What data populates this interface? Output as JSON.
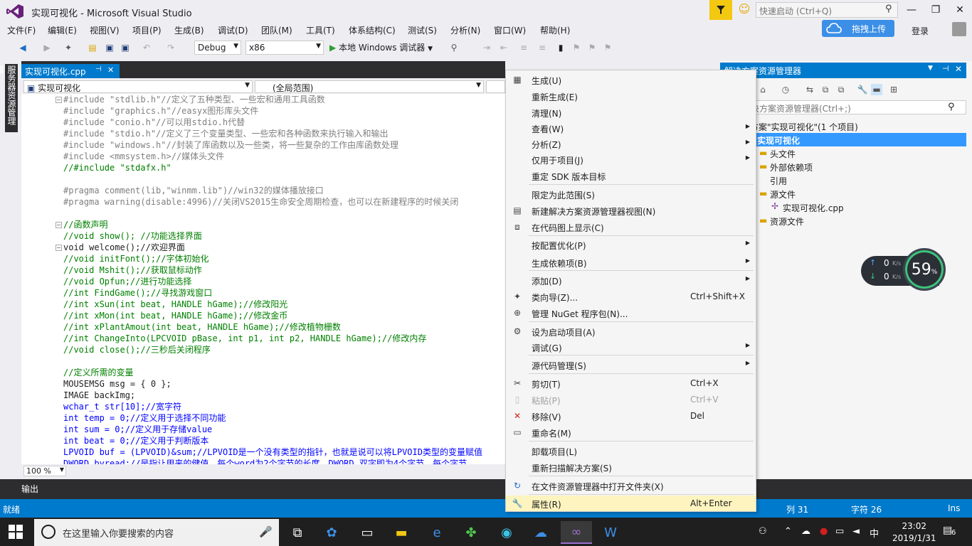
{
  "window": {
    "title": "实现可视化 - Microsoft Visual Studio",
    "quick_launch_placeholder": "快速启动 (Ctrl+Q)",
    "upload_label": "拖拽上传",
    "login_label": "登录"
  },
  "menu": [
    "文件(F)",
    "编辑(E)",
    "视图(V)",
    "项目(P)",
    "生成(B)",
    "调试(D)",
    "团队(M)",
    "工具(T)",
    "体系结构(C)",
    "测试(S)",
    "分析(N)",
    "窗口(W)",
    "帮助(H)"
  ],
  "toolbar": {
    "config": "Debug",
    "platform": "x86",
    "run_label": "本地 Windows 调试器"
  },
  "left_strip": {
    "server_tab": "服务器资源管理器"
  },
  "editor": {
    "tab_label": "实现可视化.cpp",
    "nav_project": "实现可视化",
    "nav_scope": "(全局范围)",
    "zoom": "100 %",
    "lines": [
      "#include \"stdlib.h\"//定义了五种类型、一些宏和通用工具函数",
      "#include \"graphics.h\"//easyx图形库头文件",
      "#include \"conio.h\"//可以用stdio.h代替",
      "#include \"stdio.h\"//定义了三个变量类型、一些宏和各种函数来执行输入和输出",
      "#include \"windows.h\"//封装了库函数以及一些类，将一些复杂的工作由库函数处理",
      "#include <mmsystem.h>//媒体头文件",
      "//#include \"stdafx.h\"",
      "",
      "#pragma comment(lib,\"winmm.lib\")//win32的媒体播放接口",
      "#pragma warning(disable:4996)//关闭VS2015生命安全周期检查，也可以在新建程序的时候关闭",
      "",
      "//函数声明",
      "//void show(); //功能选择界面",
      "void welcome();//欢迎界面",
      "//void initFont();//字体初始化",
      "//void Mshit();//获取鼠标动作",
      "//void Opfun;//进行功能选择",
      "//int FindGame();//寻找游戏窗口",
      "//int xSun(int beat, HANDLE hGame);//修改阳光",
      "//int xMon(int beat, HANDLE hGame);//修改金币",
      "//int xPlantAmout(int beat, HANDLE hGame);//修改植物栅数",
      "//int ChangeInto(LPCVOID pBase, int p1, int p2, HANDLE hGame);//修改内存",
      "//void close();//三秒后关闭程序",
      "",
      "//定义所需的变量",
      "MOUSEMSG msg = { 0 };",
      "IMAGE backImg;",
      "wchar_t str[10];//宽字符",
      "int temp = 0;//定义用于选择不同功能",
      "int sum = 0;//定义用于存储value",
      "int beat = 0;//定义用于判断版本",
      "LPVOID buf = (LPVOID)&sum;//LPVOID是一个没有类型的指针，也就是说可以将LPVOID类型的变量赋值",
      "DWORD byread;//是指让用来的健值，每个word为2个字节的长度，DWORD 双字即为4个字节，每个字节"
    ]
  },
  "output": {
    "tab_label": "输出"
  },
  "status": {
    "left": "就绪",
    "line": "列 31",
    "char": "字符 26",
    "mode": "Ins"
  },
  "solution": {
    "header": "解决方案资源管理器",
    "search_placeholder": "搜索解决方案资源管理器(Ctrl+;)",
    "tree": [
      "解决方案\"实现可视化\"(1 个项目)",
      "实现可视化",
      "头文件",
      "外部依赖项",
      "引用",
      "源文件",
      "实现可视化.cpp",
      "资源文件"
    ]
  },
  "speed_widget": {
    "up": "0",
    "down": "0",
    "unit": "K/s",
    "percent": "59",
    "percent_sign": "%"
  },
  "context_menu": [
    {
      "label": "生成(U)",
      "icon": "build-icon"
    },
    {
      "label": "重新生成(E)"
    },
    {
      "label": "清理(N)"
    },
    {
      "label": "查看(W)",
      "submenu": true
    },
    {
      "label": "分析(Z)",
      "submenu": true
    },
    {
      "label": "仅用于项目(J)",
      "submenu": true
    },
    {
      "label": "重定 SDK 版本目标"
    },
    {
      "label": "限定为此范围(S)"
    },
    {
      "label": "新建解决方案资源管理器视图(N)",
      "icon": "new-view-icon"
    },
    {
      "label": "在代码图上显示(C)",
      "icon": "code-map-icon"
    },
    {
      "label": "按配置优化(P)",
      "submenu": true
    },
    {
      "label": "生成依赖项(B)",
      "submenu": true
    },
    {
      "label": "添加(D)",
      "submenu": true
    },
    {
      "label": "类向导(Z)...",
      "shortcut": "Ctrl+Shift+X",
      "icon": "class-wizard-icon"
    },
    {
      "label": "管理 NuGet 程序包(N)...",
      "icon": "nuget-icon"
    },
    {
      "label": "设为启动项目(A)",
      "icon": "gear-icon"
    },
    {
      "label": "调试(G)",
      "submenu": true
    },
    {
      "label": "源代码管理(S)",
      "submenu": true
    },
    {
      "label": "剪切(T)",
      "shortcut": "Ctrl+X",
      "icon": "scissors-icon"
    },
    {
      "label": "粘贴(P)",
      "shortcut": "Ctrl+V",
      "icon": "paste-icon",
      "disabled": true
    },
    {
      "label": "移除(V)",
      "shortcut": "Del",
      "icon": "remove-icon"
    },
    {
      "label": "重命名(M)",
      "icon": "rename-icon"
    },
    {
      "label": "卸载项目(L)"
    },
    {
      "label": "重新扫描解决方案(S)"
    },
    {
      "label": "在文件资源管理器中打开文件夹(X)",
      "icon": "refresh-folder-icon"
    },
    {
      "label": "属性(R)",
      "shortcut": "Alt+Enter",
      "icon": "wrench-icon"
    }
  ],
  "taskbar": {
    "search_placeholder": "在这里输入你要搜索的内容",
    "ime": "中",
    "time": "23:02",
    "date": "2019/1/31",
    "notifications": "6"
  },
  "colors": {
    "accent": "#007acc",
    "menu_highlight": "#fdf4bf",
    "selection": "#3399ff",
    "vs_purple": "#68217a"
  }
}
